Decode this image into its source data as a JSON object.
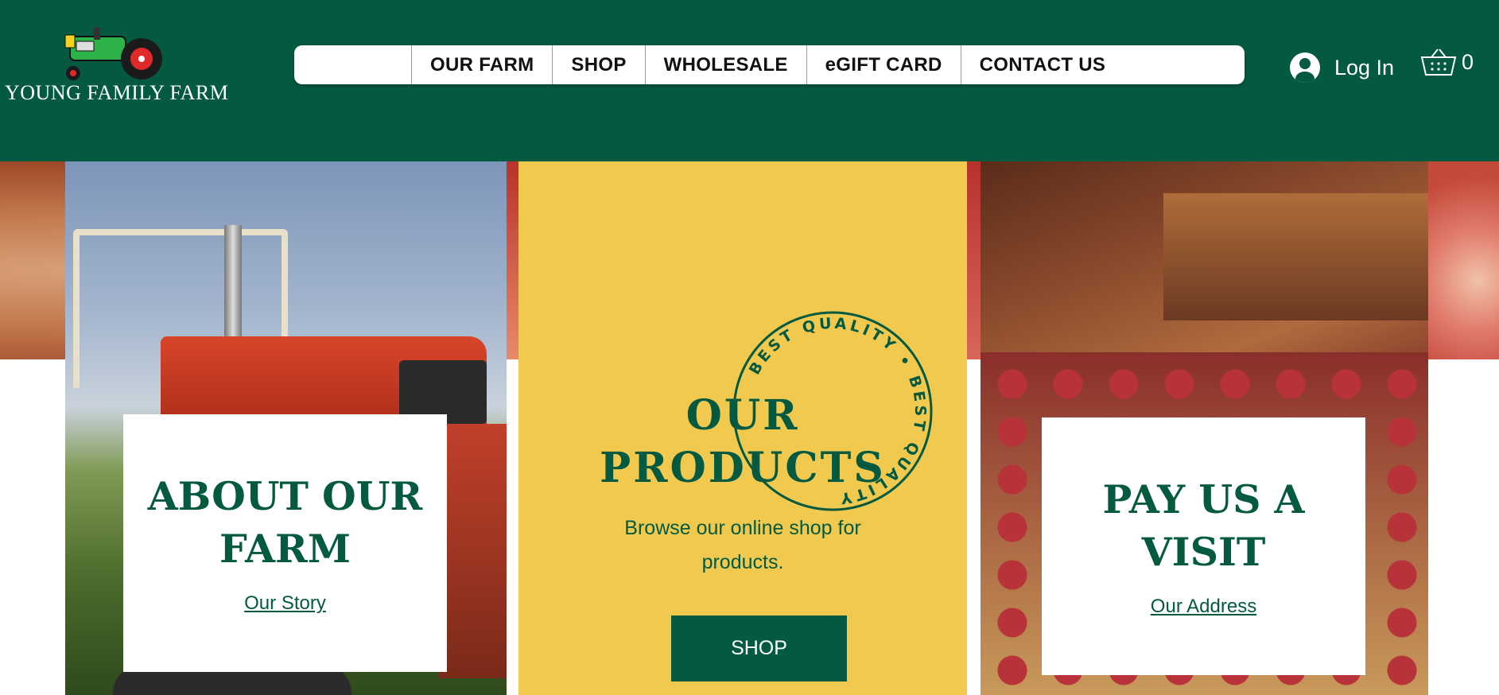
{
  "brand": {
    "name": "YOUNG FAMILY FARM"
  },
  "nav": {
    "items": [
      {
        "label": "OUR FARM"
      },
      {
        "label": "SHOP"
      },
      {
        "label": "WHOLESALE"
      },
      {
        "label": "eGIFT CARD"
      },
      {
        "label": "CONTACT US"
      }
    ]
  },
  "account": {
    "login_label": "Log In"
  },
  "cart": {
    "count": "0"
  },
  "about": {
    "title_line1": "ABOUT OUR",
    "title_line2": "FARM",
    "link": " Our Story "
  },
  "products": {
    "title_line1": "OUR",
    "title_line2": "PRODUCTS",
    "description_line1": "Browse our online shop for",
    "description_line2": "products.",
    "button": "SHOP",
    "badge_text": "BEST QUALITY • BEST QUALITY"
  },
  "visit": {
    "title_line1": "PAY US A",
    "title_line2": "VISIT",
    "link": "Our Address"
  },
  "colors": {
    "primary": "#035a41",
    "accent": "#f1c94f",
    "white": "#ffffff"
  },
  "icons": [
    "tractor-logo-icon",
    "user-avatar-icon",
    "shopping-basket-icon"
  ]
}
